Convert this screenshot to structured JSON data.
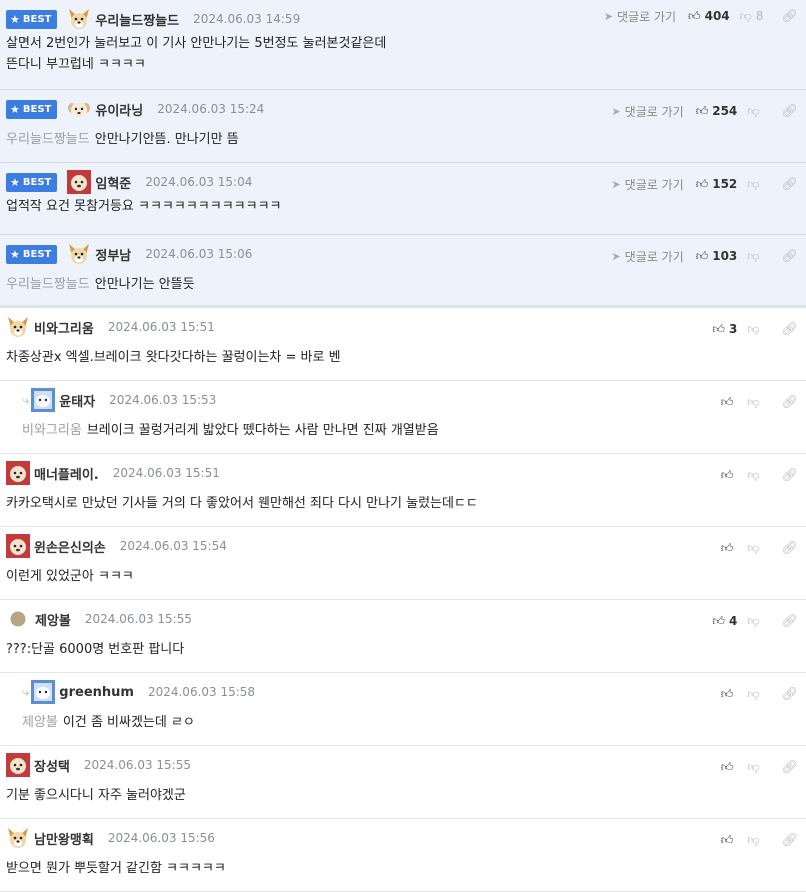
{
  "labels": {
    "best": "BEST",
    "reply_to": "댓글로 가기"
  },
  "colors": {
    "badge": "#3b7de0",
    "best_bg": "#eef3fb"
  },
  "icons": {
    "star": "star-icon",
    "reply": "paper-plane-icon",
    "up": "thumbs-up-icon",
    "down": "thumbs-down-icon",
    "link": "link-icon"
  },
  "comments": [
    {
      "nick": "우리늘드짱늘드",
      "date": "2024.06.03 14:59",
      "lines": [
        "살면서 2번인가 눌러보고 이 기사 안만나기는 5번정도 눌러본것같은데",
        "뜬다니 부끄럽네 ㅋㅋㅋㅋ"
      ],
      "up": "404",
      "down": "8"
    },
    {
      "nick": "유이라닝",
      "date": "2024.06.03 15:24",
      "mention": "우리늘드짱늘드",
      "lines": [
        "안만나기안뜸. 만나기만 뜸"
      ],
      "up": "254"
    },
    {
      "nick": "임혁준",
      "date": "2024.06.03 15:04",
      "lines": [
        "업적작 요건 못참거등요 ㅋㅋㅋㅋㅋㅋㅋㅋㅋㅋㅋㅋ"
      ],
      "up": "152"
    },
    {
      "nick": "정부남",
      "date": "2024.06.03 15:06",
      "mention": "우리늘드짱늘드",
      "lines": [
        "안만나기는 안뜰듯"
      ],
      "up": "103"
    },
    {
      "nick": "비와그리움",
      "date": "2024.06.03 15:51",
      "lines": [
        "차종상관x 엑셀.브레이크 왓다갓다하는 꿀렁이는차 = 바로 벤"
      ],
      "up": "3"
    },
    {
      "nick": "윤태자",
      "date": "2024.06.03 15:53",
      "mention": "비와그리움",
      "lines": [
        "브레이크 꿀렁거리게 밟았다 뗐다하는 사람 만나면 진짜 개열받음"
      ]
    },
    {
      "nick": "매너플레이.",
      "date": "2024.06.03 15:51",
      "lines": [
        "카카오택시로 만났던 기사들 거의 다 좋았어서 웬만해선 죄다 다시 만나기 눌렀는데ㄷㄷ"
      ]
    },
    {
      "nick": "윈손은신의손",
      "date": "2024.06.03 15:54",
      "lines": [
        "이런게 있었군아 ㅋㅋㅋ"
      ]
    },
    {
      "nick": "제앙볼",
      "date": "2024.06.03 15:55",
      "lines": [
        "???:단골 6000명 번호판 팝니다"
      ],
      "up": "4"
    },
    {
      "nick": "greenhum",
      "date": "2024.06.03 15:58",
      "mention": "제앙볼",
      "lines": [
        "이건 좀 비싸겠는데 ㄹㅇ"
      ]
    },
    {
      "nick": "장성택",
      "date": "2024.06.03 15:55",
      "lines": [
        "기분 좋으시다니 자주 눌러야겠군"
      ]
    },
    {
      "nick": "남만왕맹획",
      "date": "2024.06.03 15:56",
      "lines": [
        "받으면 뭔가 뿌듯할거 같긴함 ㅋㅋㅋㅋㅋ"
      ]
    }
  ]
}
